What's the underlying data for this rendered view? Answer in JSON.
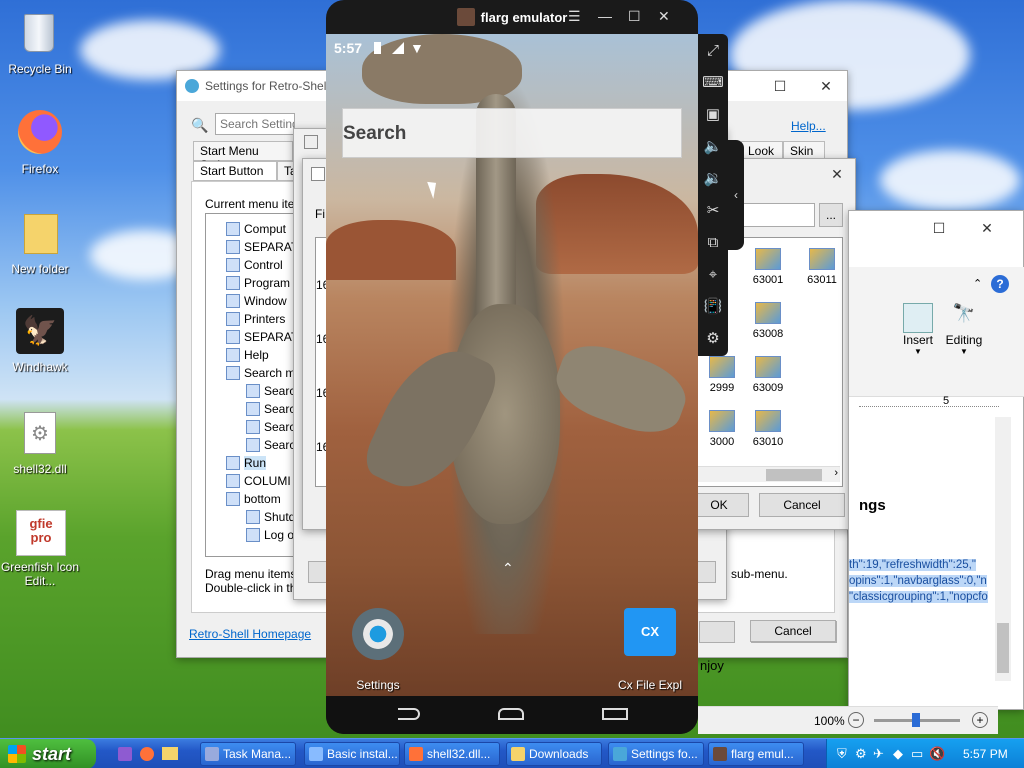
{
  "desktop": {
    "icons": [
      {
        "label": "Recycle Bin",
        "icon": "recycle-bin-icon"
      },
      {
        "label": "Firefox",
        "icon": "firefox-icon"
      },
      {
        "label": "New folder",
        "icon": "folder-icon"
      },
      {
        "label": "Windhawk",
        "icon": "windhawk-icon"
      },
      {
        "label": "shell32.dll",
        "icon": "dll-file-icon"
      },
      {
        "label": "Greenfish Icon Edit...",
        "icon": "greenfish-icon"
      }
    ]
  },
  "settings_window": {
    "title": "Settings for Retro-Shell",
    "search_placeholder": "Search Settings",
    "help_link": "Help...",
    "tabs_row1": [
      "Start Menu Style",
      "Look",
      "Skin"
    ],
    "tabs_row2": [
      "Start Button",
      "Ta"
    ],
    "section_label": "Current menu ite",
    "tree_items": [
      "Comput",
      "SEPARAT",
      "Control",
      "Program",
      "Window",
      "Printers",
      "SEPARAT",
      "Help",
      "Search m",
      "Searc",
      "Searc",
      "Searc",
      "Searc",
      "Run",
      "COLUMI",
      "bottom",
      "Shutd",
      "Log o"
    ],
    "hint_line1": "Drag menu items",
    "hint_line2": "Double-click in th",
    "hint_suffix": "sub-menu.",
    "homepage_link": "Retro-Shell Homepage",
    "cancel": "Cancel"
  },
  "icon_picker": {
    "fi_label": "Fi",
    "numbers_left": [
      "16",
      "16",
      "16",
      "16"
    ],
    "icons": [
      {
        "label": "63001"
      },
      {
        "label": "63011"
      },
      {
        "label": "63008"
      },
      {
        "label": "2999"
      },
      {
        "label": "63009"
      },
      {
        "label": "3000"
      },
      {
        "label": "63010"
      }
    ],
    "browse": "...",
    "ok": "OK",
    "cancel": "Cancel"
  },
  "word_window": {
    "insert": "Insert",
    "editing": "Editing",
    "ruler_mark": "5",
    "heading_frag": "ngs",
    "code_line1": "th\":19,\"refreshwidth\":25,\"",
    "code_line2": "opins\":1,\"navbarglass\":0,\"n",
    "code_line3": "\"classicgrouping\":1,\"nopcfo",
    "enjoy": "njoy",
    "zoom": "100%"
  },
  "emulator": {
    "title": "flarg emulator",
    "time": "5:57",
    "search_text": "Search",
    "apps": [
      {
        "label": "Settings",
        "icon": "settings-gear-icon"
      },
      {
        "label": "Cx File Expl",
        "icon": "cx-file-explorer-icon"
      }
    ]
  },
  "taskbar": {
    "start": "start",
    "items": [
      "Task Mana...",
      "Basic instal...",
      "shell32.dll...",
      "Downloads",
      "Settings fo...",
      "flarg emul..."
    ],
    "clock": "5:57 PM"
  },
  "colors": {
    "taskbar": "#2358c7",
    "start": "#3c9a2e",
    "tray": "#0f8ae8"
  }
}
